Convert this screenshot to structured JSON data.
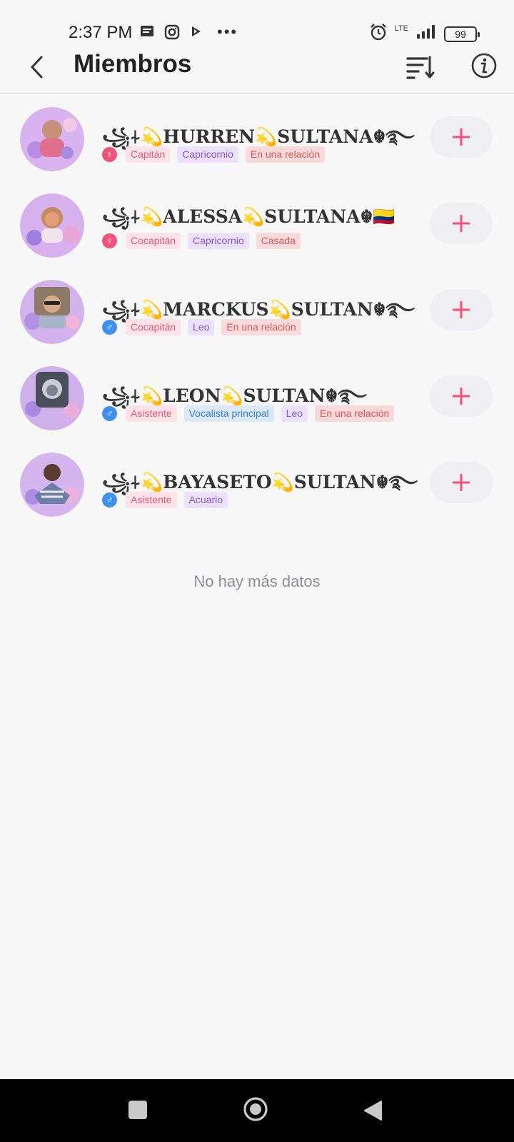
{
  "status_bar": {
    "time": "2:37 PM",
    "network": "LTE",
    "battery": "99",
    "left_icons": [
      "message-icon",
      "instagram-icon",
      "play-icon",
      "more-dots-icon"
    ],
    "right_icons": [
      "alarm-icon",
      "signal-icon",
      "battery-icon"
    ],
    "dots": "•••"
  },
  "header": {
    "title": "Miembros",
    "icons": [
      "back-arrow-icon",
      "sort-icon",
      "info-icon"
    ]
  },
  "members": [
    {
      "name": "꧁⍭💫HURREN💫SULTANA☬࿐",
      "gender": "female",
      "gender_symbol": "♀",
      "avatar_color": "#d9b3ef",
      "tags": [
        {
          "text": "Capitán",
          "kind": "role"
        },
        {
          "text": "Capricornio",
          "kind": "sign"
        },
        {
          "text": "En una relación",
          "kind": "status"
        }
      ]
    },
    {
      "name": "꧁⍭💫ALESSA💫SULTANA☬🇨🇴",
      "gender": "female",
      "gender_symbol": "♀",
      "avatar_color": "#d7b0ee",
      "tags": [
        {
          "text": "Cocapitán",
          "kind": "role"
        },
        {
          "text": "Capricornio",
          "kind": "sign"
        },
        {
          "text": "Casada",
          "kind": "status"
        }
      ]
    },
    {
      "name": "꧁⍭💫MARCKUS💫SULTAN☬࿐",
      "gender": "male",
      "gender_symbol": "♂",
      "avatar_color": "#d3b1ec",
      "tags": [
        {
          "text": "Cocapitán",
          "kind": "role"
        },
        {
          "text": "Leo",
          "kind": "sign"
        },
        {
          "text": "En una relación",
          "kind": "status"
        }
      ]
    },
    {
      "name": "꧁⍭💫LEON💫SULTAN☬࿐",
      "gender": "male",
      "gender_symbol": "♂",
      "avatar_color": "#cfb0ea",
      "tags": [
        {
          "text": "Asistente",
          "kind": "role"
        },
        {
          "text": "Vocalista principal",
          "kind": "vocal"
        },
        {
          "text": "Leo",
          "kind": "sign"
        },
        {
          "text": "En una relación",
          "kind": "status"
        }
      ]
    },
    {
      "name": "꧁⍭💫BAYASETO💫SULTAN☬࿐",
      "gender": "male",
      "gender_symbol": "♂",
      "avatar_color": "#d6b4ee",
      "tags": [
        {
          "text": "Asistente",
          "kind": "role"
        },
        {
          "text": "Acuario",
          "kind": "sign"
        }
      ]
    }
  ],
  "add_button_icon": "plus-icon",
  "footer_text": "No hay más datos",
  "colors": {
    "accent": "#f0527a",
    "female": "#f0527a",
    "male": "#3d8ff2",
    "background": "#f7f7f8"
  },
  "nav_bar": {
    "icons": [
      "recents-square-icon",
      "home-circle-icon",
      "back-triangle-icon"
    ]
  }
}
